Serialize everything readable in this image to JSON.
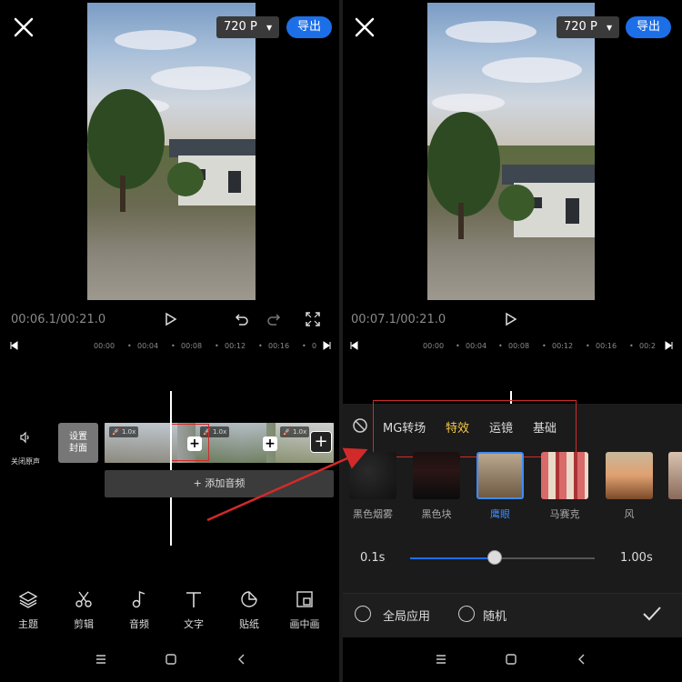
{
  "left": {
    "resolution": "720 P",
    "export_label": "导出",
    "time": "00:06.1/00:21.0",
    "ruler": [
      "00:00",
      "00:04",
      "00:08",
      "00:12",
      "00:16",
      "0"
    ],
    "mute_label": "关闭原声",
    "cover_label_1": "设置",
    "cover_label_2": "封面",
    "speeds": [
      "1.0x",
      "1.0x",
      "1.0x"
    ],
    "add_audio": "添加音频",
    "tools": [
      {
        "label": "主题",
        "icon": "layers-icon"
      },
      {
        "label": "剪辑",
        "icon": "scissors-icon"
      },
      {
        "label": "音频",
        "icon": "music-note-icon"
      },
      {
        "label": "文字",
        "icon": "text-icon"
      },
      {
        "label": "贴纸",
        "icon": "sticker-icon"
      },
      {
        "label": "画中画",
        "icon": "picture-in-picture-icon"
      }
    ]
  },
  "right": {
    "resolution": "720 P",
    "export_label": "导出",
    "time": "00:07.1/00:21.0",
    "ruler": [
      "00:00",
      "00:04",
      "00:08",
      "00:12",
      "00:16",
      "00:2"
    ],
    "tabs": [
      "MG转场",
      "特效",
      "运镜",
      "基础"
    ],
    "active_tab": "特效",
    "effects": [
      "黑色烟雾",
      "黑色块",
      "鹰眼",
      "马赛克",
      "风"
    ],
    "selected_effect": "鹰眼",
    "duration_min": "0.1s",
    "duration_max": "1.00s",
    "slider_fraction": 0.46,
    "apply_all_label": "全局应用",
    "random_label": "随机"
  },
  "colors": {
    "accent_blue": "#1d6fe8",
    "active_tab": "#f5c84a",
    "annotation_red": "#d22a2a"
  }
}
